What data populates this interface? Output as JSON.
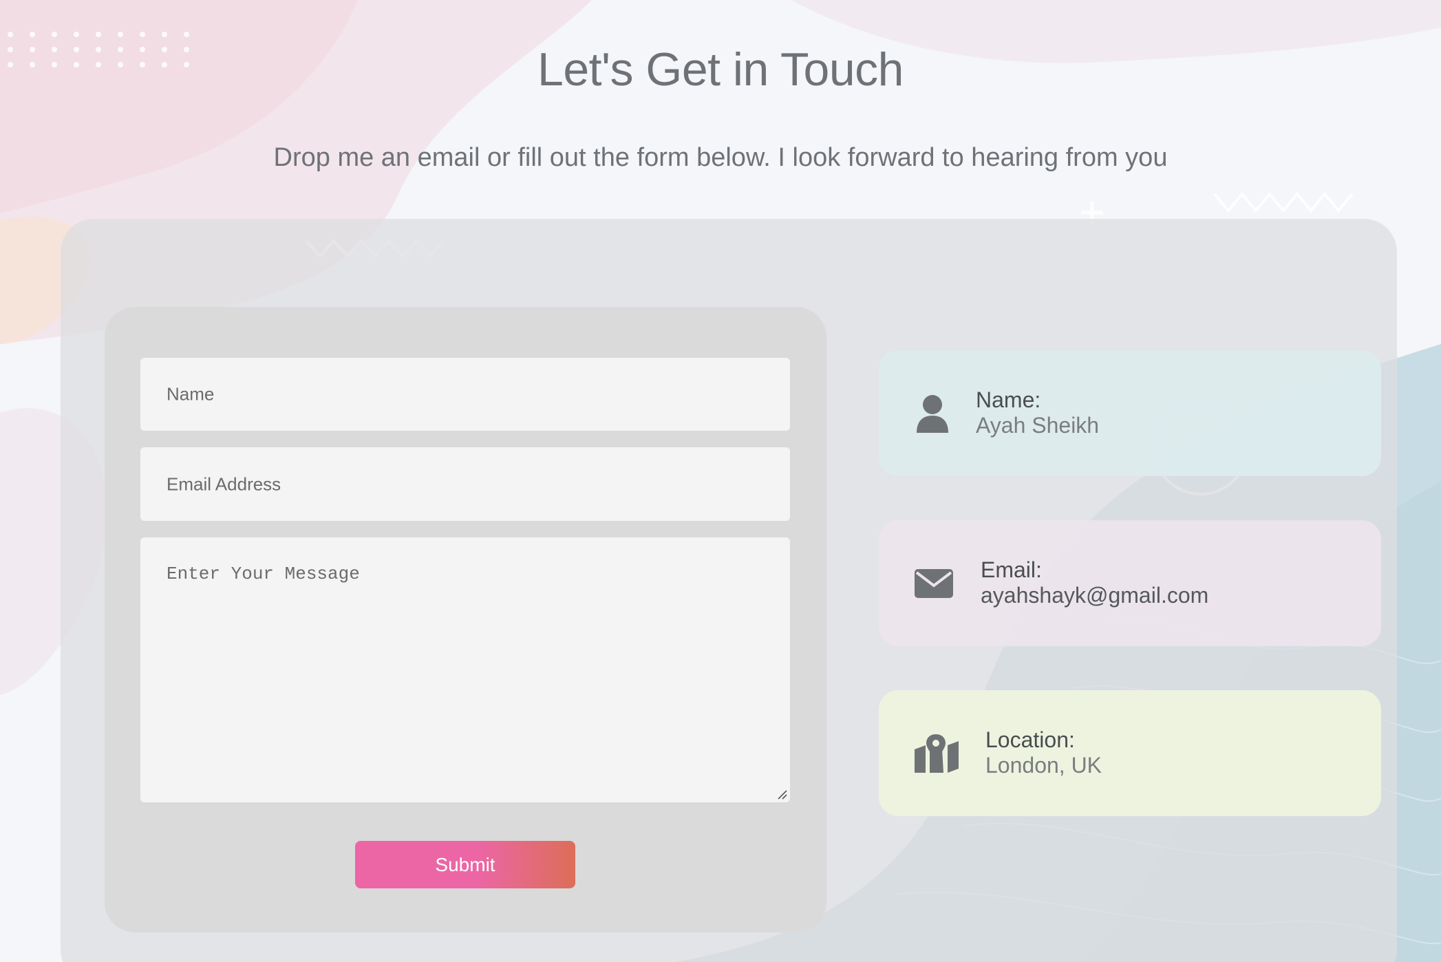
{
  "page": {
    "title": "Let's Get in Touch",
    "subtitle": "Drop me an email or fill out the form below. I look forward to hearing from you"
  },
  "form": {
    "name_placeholder": "Name",
    "email_placeholder": "Email Address",
    "message_placeholder": "Enter Your Message",
    "submit_label": "Submit"
  },
  "contact": {
    "name": {
      "label": "Name:",
      "value": "Ayah Sheikh",
      "icon": "user-icon"
    },
    "email": {
      "label": "Email:",
      "value": "ayahshayk@gmail.com",
      "icon": "envelope-icon"
    },
    "location": {
      "label": "Location:",
      "value": "London, UK",
      "icon": "map-location-icon"
    }
  },
  "colors": {
    "submit_gradient_start": "#ec66a6",
    "submit_gradient_end": "#dc6e58",
    "name_card": "#dcecee",
    "email_card": "#ece4ec",
    "location_card": "#eef3de",
    "icon": "#6f7275"
  }
}
